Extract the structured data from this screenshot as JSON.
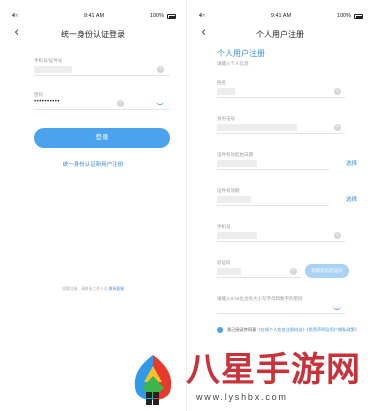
{
  "status_bar": {
    "time": "9:41 AM",
    "battery": "100%",
    "signal": "•ll  ≈"
  },
  "login": {
    "title": "统一身份认证登录",
    "back_icon": "back-chevron-icon",
    "account_label": "手机号/证件号",
    "password_label": "密码",
    "password_value": "••••••••••",
    "login_button": "登录",
    "register_link": "统一身份认证新用户注册",
    "footer_hint": "如需注册、请联系工作人员",
    "footer_link": "联系客服"
  },
  "register": {
    "title": "个人用户注册",
    "heading": "个人用户注册",
    "subheading": "请输入个人信息",
    "fields": {
      "name": "姓名",
      "id_number": "身份证号",
      "id_start_date": "证件有效起始日期",
      "id_end_date": "证件有效期",
      "phone": "手机号",
      "sms_code": "验证码",
      "password": "请输入8-16位含有大小写字母和数字的密码"
    },
    "select_label": "选择",
    "sms_button": "获取短信验证码",
    "agreement_prefix": "我已阅读并同意",
    "agreement_link_1": "《在线个人实名注册协议》",
    "agreement_link_2": "《免责声明及用户隐私政策》"
  },
  "watermark": {
    "title": "八星手游网",
    "url": "www.lyshbx.com"
  },
  "colors": {
    "accent": "#4aa3ec",
    "link": "#3d8fd6",
    "brand": "#c8323a"
  }
}
